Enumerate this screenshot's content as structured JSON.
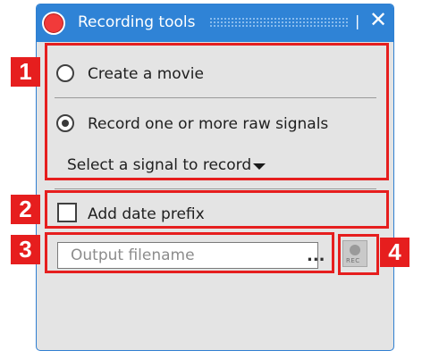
{
  "window": {
    "title": "Recording tools",
    "pin_glyph": "❘",
    "close_glyph": "✕",
    "status_icon": "record-dot-icon"
  },
  "section1": {
    "option_movie": "Create a movie",
    "option_raw": "Record one or more raw signals",
    "selected_option": "Record one or more raw signals",
    "signal_select": "Select a signal to record"
  },
  "section2": {
    "date_prefix_label": "Add date prefix",
    "date_prefix_checked": false
  },
  "section3": {
    "filename_value": "",
    "filename_placeholder": "Output filename",
    "browse_label": "...",
    "rec_label": "REC"
  },
  "callouts": {
    "b1": "1",
    "b2": "2",
    "b3": "3",
    "b4": "4"
  },
  "colors": {
    "titlebar": "#2f83d6",
    "highlight": "#e61e1e",
    "panel": "#e4e4e4"
  }
}
